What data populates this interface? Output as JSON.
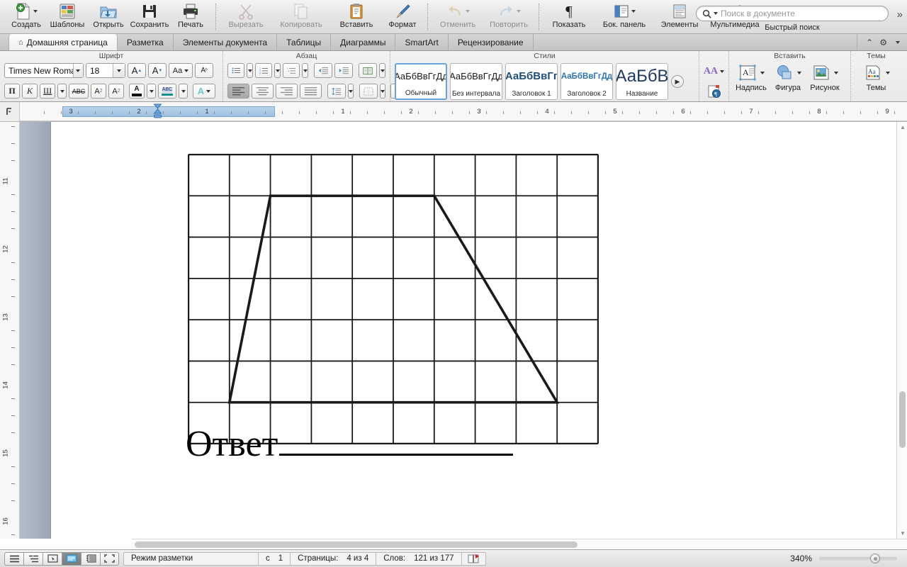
{
  "standard_toolbar": {
    "items": [
      {
        "label": "Создать",
        "icon": "new-document-icon",
        "dropdown": true,
        "dim": false
      },
      {
        "label": "Шаблоны",
        "icon": "templates-icon",
        "dropdown": false,
        "dim": false
      },
      {
        "label": "Открыть",
        "icon": "open-folder-icon",
        "dropdown": false,
        "dim": false
      },
      {
        "label": "Сохранить",
        "icon": "save-disk-icon",
        "dropdown": false,
        "dim": false
      },
      {
        "label": "Печать",
        "icon": "printer-icon",
        "dropdown": false,
        "dim": false
      },
      {
        "label": "Вырезать",
        "icon": "scissors-icon",
        "dropdown": false,
        "dim": true
      },
      {
        "label": "Копировать",
        "icon": "copy-icon",
        "dropdown": false,
        "dim": true
      },
      {
        "label": "Вставить",
        "icon": "clipboard-paste-icon",
        "dropdown": false,
        "dim": false
      },
      {
        "label": "Формат",
        "icon": "format-brush-icon",
        "dropdown": false,
        "dim": false
      },
      {
        "label": "Отменить",
        "icon": "undo-arrow-icon",
        "dropdown": true,
        "dim": true
      },
      {
        "label": "Повторить",
        "icon": "redo-arrow-icon",
        "dropdown": true,
        "dim": true
      },
      {
        "label": "Показать",
        "icon": "pilcrow-icon",
        "dropdown": false,
        "dim": false
      },
      {
        "label": "Бок. панель",
        "icon": "sidebar-panel-icon",
        "dropdown": true,
        "dim": false
      },
      {
        "label": "Элементы",
        "icon": "elements-gallery-icon",
        "dropdown": false,
        "dim": false
      },
      {
        "label": "Мультимедиа",
        "icon": "media-browser-icon",
        "dropdown": false,
        "dim": false
      }
    ],
    "search": {
      "placeholder": "Поиск в документе",
      "value": "",
      "label": "Быстрый поиск",
      "icon": "search-magnifier-icon"
    },
    "overflow_icon": "double-chevron-right-icon"
  },
  "ribbon_tabs": {
    "items": [
      {
        "label": "Домашняя страница",
        "active": true,
        "icon": "home-icon"
      },
      {
        "label": "Разметка",
        "active": false,
        "icon": ""
      },
      {
        "label": "Элементы документа",
        "active": false,
        "icon": ""
      },
      {
        "label": "Таблицы",
        "active": false,
        "icon": ""
      },
      {
        "label": "Диаграммы",
        "active": false,
        "icon": ""
      },
      {
        "label": "SmartArt",
        "active": false,
        "icon": ""
      },
      {
        "label": "Рецензирование",
        "active": false,
        "icon": ""
      }
    ],
    "right_icons": [
      "chevron-up-icon",
      "gear-icon"
    ]
  },
  "ribbon": {
    "font_group": {
      "title": "Шрифт",
      "font_family": "Times New Roman",
      "font_size": "18",
      "buttons_row1": [
        {
          "name": "grow-font-button",
          "label": "A",
          "sup": "▲"
        },
        {
          "name": "shrink-font-button",
          "label": "A",
          "sup": "▼"
        },
        {
          "name": "change-case-button",
          "label": "Aa"
        },
        {
          "name": "clear-formatting-button",
          "label": "Ab"
        }
      ],
      "buttons_row2": [
        {
          "name": "bold-button",
          "label": "П"
        },
        {
          "name": "italic-button",
          "label": "К"
        },
        {
          "name": "underline-button",
          "label": "Ш"
        },
        {
          "name": "strikethrough-button",
          "label": "ABC"
        },
        {
          "name": "superscript-button",
          "label": "A²"
        },
        {
          "name": "subscript-button",
          "label": "A₂"
        },
        {
          "name": "font-color-button",
          "label": "A"
        },
        {
          "name": "highlight-button",
          "label": "ABC"
        },
        {
          "name": "text-effects-button",
          "label": "A"
        }
      ]
    },
    "paragraph_group": {
      "title": "Абзац",
      "buttons_row1": [
        {
          "name": "bulleted-list-button"
        },
        {
          "name": "numbered-list-button"
        },
        {
          "name": "multilevel-list-button"
        },
        {
          "name": "decrease-indent-button"
        },
        {
          "name": "increase-indent-button"
        },
        {
          "name": "columns-button"
        }
      ],
      "buttons_row2": [
        {
          "name": "align-left-button",
          "active": true
        },
        {
          "name": "align-center-button",
          "active": false
        },
        {
          "name": "align-right-button",
          "active": false
        },
        {
          "name": "align-justify-button",
          "active": false
        },
        {
          "name": "line-spacing-button",
          "active": false
        },
        {
          "name": "borders-button",
          "active": false
        },
        {
          "name": "shading-button",
          "active": false
        }
      ]
    },
    "styles_group": {
      "title": "Стили",
      "cards": [
        {
          "preview": "АаБбВвГгДд",
          "name": "Обычный",
          "selected": true,
          "size": "13px",
          "weight": "normal",
          "color": "#1a1a1a"
        },
        {
          "preview": "АаБбВвГгДд",
          "name": "Без интервала",
          "selected": false,
          "size": "13px",
          "weight": "normal",
          "color": "#1a1a1a"
        },
        {
          "preview": "АаБбВвГг",
          "name": "Заголовок 1",
          "selected": false,
          "size": "15px",
          "weight": "bold",
          "color": "#1f4e79"
        },
        {
          "preview": "АаБбВвГгДд",
          "name": "Заголовок 2",
          "selected": false,
          "size": "12px",
          "weight": "bold",
          "color": "#2e75b6"
        },
        {
          "preview": "АаБбВ",
          "name": "Название",
          "selected": false,
          "size": "24px",
          "weight": "normal",
          "color": "#1f3864"
        }
      ],
      "next_icon": "gallery-next-arrow-icon"
    },
    "insert_group": {
      "title": "Вставить",
      "items": [
        {
          "label": "Надпись",
          "icon": "text-box-icon",
          "dropdown": true
        },
        {
          "label": "Фигура",
          "icon": "shape-icon",
          "dropdown": true
        },
        {
          "label": "Рисунок",
          "icon": "picture-icon",
          "dropdown": true
        }
      ],
      "side_buttons": [
        {
          "name": "wordart-button",
          "icon": "wordart-icon"
        },
        {
          "name": "document-elements-button",
          "icon": "doc-element-icon"
        }
      ]
    },
    "themes_group": {
      "title": "Темы",
      "items": [
        {
          "label": "Темы",
          "icon": "themes-icon",
          "dropdown": true
        }
      ]
    }
  },
  "ruler": {
    "corner_icon": "tab-stop-selector-icon",
    "horizontal_numbers_left": [
      "3",
      "2",
      "1"
    ],
    "horizontal_numbers_right": [
      "1",
      "2",
      "3",
      "4",
      "5",
      "6",
      "7",
      "8",
      "9"
    ],
    "vertical_numbers": [
      "11",
      "12",
      "13",
      "14",
      "15",
      "16"
    ],
    "indent_marker_icon": "hourglass-indent-marker-icon"
  },
  "document": {
    "answer_word": "Ответ",
    "answer_blank": "",
    "figure": {
      "name": "grid-with-trapezoid-figure",
      "grid_columns": 10,
      "grid_rows": 7,
      "cell_size_px": 57.6,
      "shape": "trapezoid",
      "vertices_in_cells": [
        {
          "col": 1,
          "row": 6
        },
        {
          "col": 2,
          "row": 1
        },
        {
          "col": 6,
          "row": 1
        },
        {
          "col": 9,
          "row": 6
        }
      ]
    }
  },
  "status_bar": {
    "view_buttons": [
      {
        "name": "draft-view-button",
        "active": false,
        "icon": "lines-icon"
      },
      {
        "name": "outline-view-button",
        "active": false,
        "icon": "outline-icon"
      },
      {
        "name": "publishing-view-button",
        "active": false,
        "icon": "cursor-box-icon"
      },
      {
        "name": "print-layout-view-button",
        "active": true,
        "icon": "page-layout-icon"
      },
      {
        "name": "notebook-view-button",
        "active": false,
        "icon": "notebook-icon"
      },
      {
        "name": "focus-view-button",
        "active": false,
        "icon": "fullscreen-icon"
      }
    ],
    "mode_label": "Режим разметки",
    "section_label": "с",
    "section_value": "1",
    "pages_label": "Страницы:",
    "pages_value": "4 из 4",
    "words_label": "Слов:",
    "words_value": "121 из 177",
    "spellcheck_icon": "spellcheck-book-icon",
    "zoom_percent": "340%"
  },
  "colors": {
    "accent_blue": "#6aa3dd",
    "nav_pane": "#a7b0be",
    "toolbar_bg": "#e4e4e4",
    "tab_active": "#fdfdfd",
    "figure_stroke": "#1a1a1a"
  }
}
